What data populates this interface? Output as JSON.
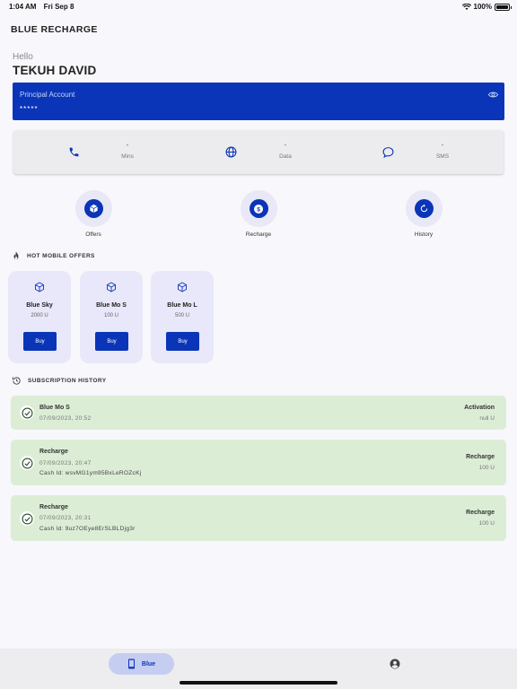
{
  "status": {
    "time": "1:04 AM",
    "date": "Fri Sep 8",
    "battery": "100%"
  },
  "app": {
    "title": "BLUE RECHARGE"
  },
  "user": {
    "greeting": "Hello",
    "name": "TEKUH DAVID"
  },
  "account": {
    "label": "Principal Account",
    "value": "*****"
  },
  "usage": [
    {
      "value": "-",
      "label": "Mins",
      "icon": "phone-icon"
    },
    {
      "value": "-",
      "label": "Data",
      "icon": "globe-icon"
    },
    {
      "value": "-",
      "label": "SMS",
      "icon": "chat-icon"
    }
  ],
  "actions": [
    {
      "label": "Offers",
      "icon": "box-icon"
    },
    {
      "label": "Recharge",
      "icon": "dollar-icon"
    },
    {
      "label": "History",
      "icon": "refresh-icon"
    }
  ],
  "offers_section": {
    "title": "HOT MOBILE OFFERS"
  },
  "offers": [
    {
      "name": "Blue Sky",
      "price": "2000 U",
      "buy": "Buy"
    },
    {
      "name": "Blue Mo S",
      "price": "100 U",
      "buy": "Buy"
    },
    {
      "name": "Blue Mo L",
      "price": "500 U",
      "buy": "Buy"
    }
  ],
  "history_section": {
    "title": "SUBSCRIPTION HISTORY"
  },
  "history": [
    {
      "title": "Blue Mo S",
      "date": "07/09/2023, 20:52",
      "cash": "",
      "type": "Activation",
      "amount": "null U"
    },
    {
      "title": "Recharge",
      "date": "07/09/2023, 20:47",
      "cash": "Cash Id: wsvMG1ym95BxLeROZcKj",
      "type": "Recharge",
      "amount": "100 U"
    },
    {
      "title": "Recharge",
      "date": "07/09/2023, 20:31",
      "cash": "Cash Id: 9uz7OEye8ErSLBLDjg3r",
      "type": "Recharge",
      "amount": "100 U"
    }
  ],
  "nav": {
    "blue_label": "Blue"
  },
  "colors": {
    "primary": "#0a35b8",
    "success_bg": "#dcedd6",
    "card_bg": "#e8e8fa"
  }
}
